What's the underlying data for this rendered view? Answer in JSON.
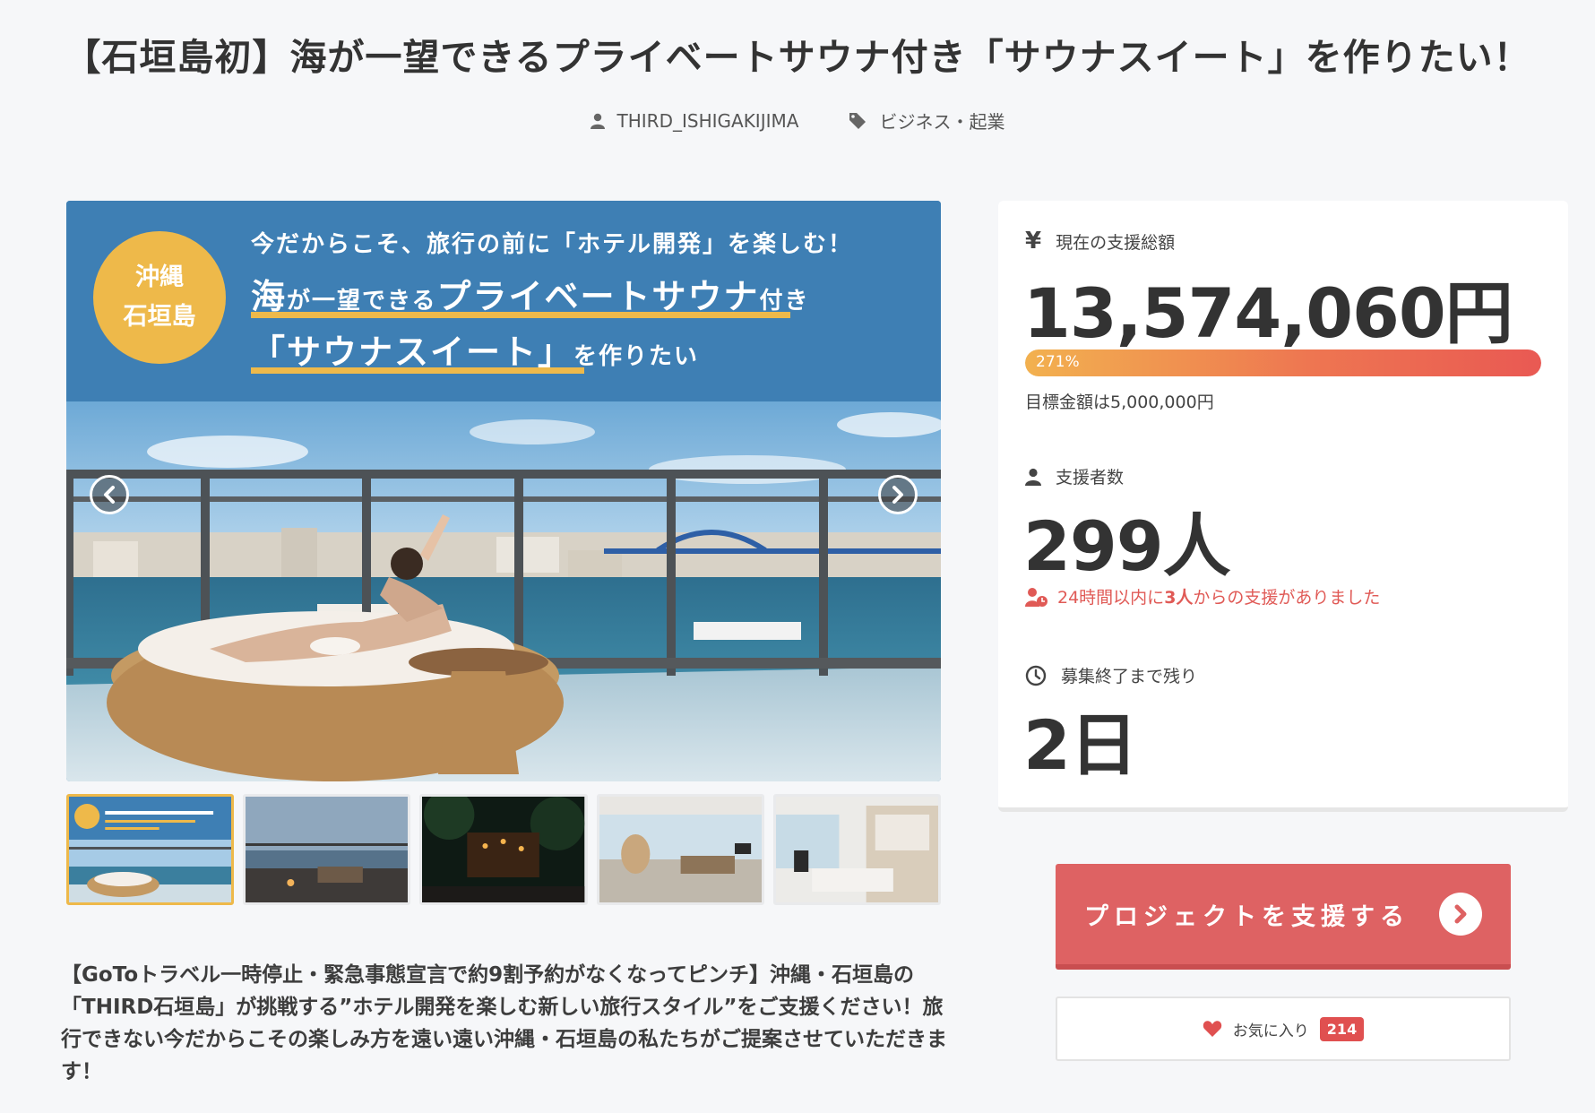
{
  "page": {
    "title": "【石垣島初】海が一望できるプライベートサウナ付き「サウナスイート」を作りたい！",
    "owner": "THIRD_ISHIGAKIJIMA",
    "category": "ビジネス・起業"
  },
  "hero": {
    "badge_line1": "沖縄",
    "badge_line2": "石垣島",
    "tagline": "今だからこそ、旅行の前に「ホテル開発」を楽しむ！",
    "headline1_a": "海",
    "headline1_b": "が一望できる",
    "headline1_c": "プライベートサウナ",
    "headline1_d": "付き",
    "headline2_a": "「サウナスイート」",
    "headline2_b": "を作りたい"
  },
  "thumbnails": [
    {
      "name": "thumbnail-1",
      "active": true
    },
    {
      "name": "thumbnail-2",
      "active": false
    },
    {
      "name": "thumbnail-3",
      "active": false
    },
    {
      "name": "thumbnail-4",
      "active": false
    },
    {
      "name": "thumbnail-5",
      "active": false
    }
  ],
  "description": "【GoToトラベル一時停止・緊急事態宣言で約9割予約がなくなってピンチ】沖縄・石垣島の「THIRD石垣島」が挑戦する”ホテル開発を楽しむ新しい旅行スタイル”をご支援ください！旅行できない今だからこその楽しみ方を遠い遠い沖縄・石垣島の私たちがご提案させていただきます！",
  "stats": {
    "amount_label": "現在の支援総額",
    "amount": "13,574,060円",
    "progress_label": "271%",
    "progress_ratio": 2.71,
    "goal_text": "目標金額は5,000,000円",
    "supporters_label": "支援者数",
    "supporters": "299人",
    "recent_pre": "24時間以内に",
    "recent_count": "3人",
    "recent_post": "からの支援がありました",
    "remaining_label": "募集終了まで残り",
    "remaining": "2日"
  },
  "actions": {
    "support_label": "プロジェクトを支援する",
    "favorite_label": "お気に入り",
    "favorite_count": "214"
  },
  "colors": {
    "accent": "#de6263",
    "banner_blue": "#3e7fb4",
    "badge_yellow": "#eeb94a",
    "alert_red": "#e05a56"
  },
  "icons": {
    "owner": "user-icon",
    "category": "tag-icon",
    "amount": "yen-icon",
    "supporters": "user-icon",
    "recent": "user-clock-icon",
    "remaining": "clock-icon",
    "support": "chevron-right-circle-icon",
    "favorite": "heart-icon"
  }
}
